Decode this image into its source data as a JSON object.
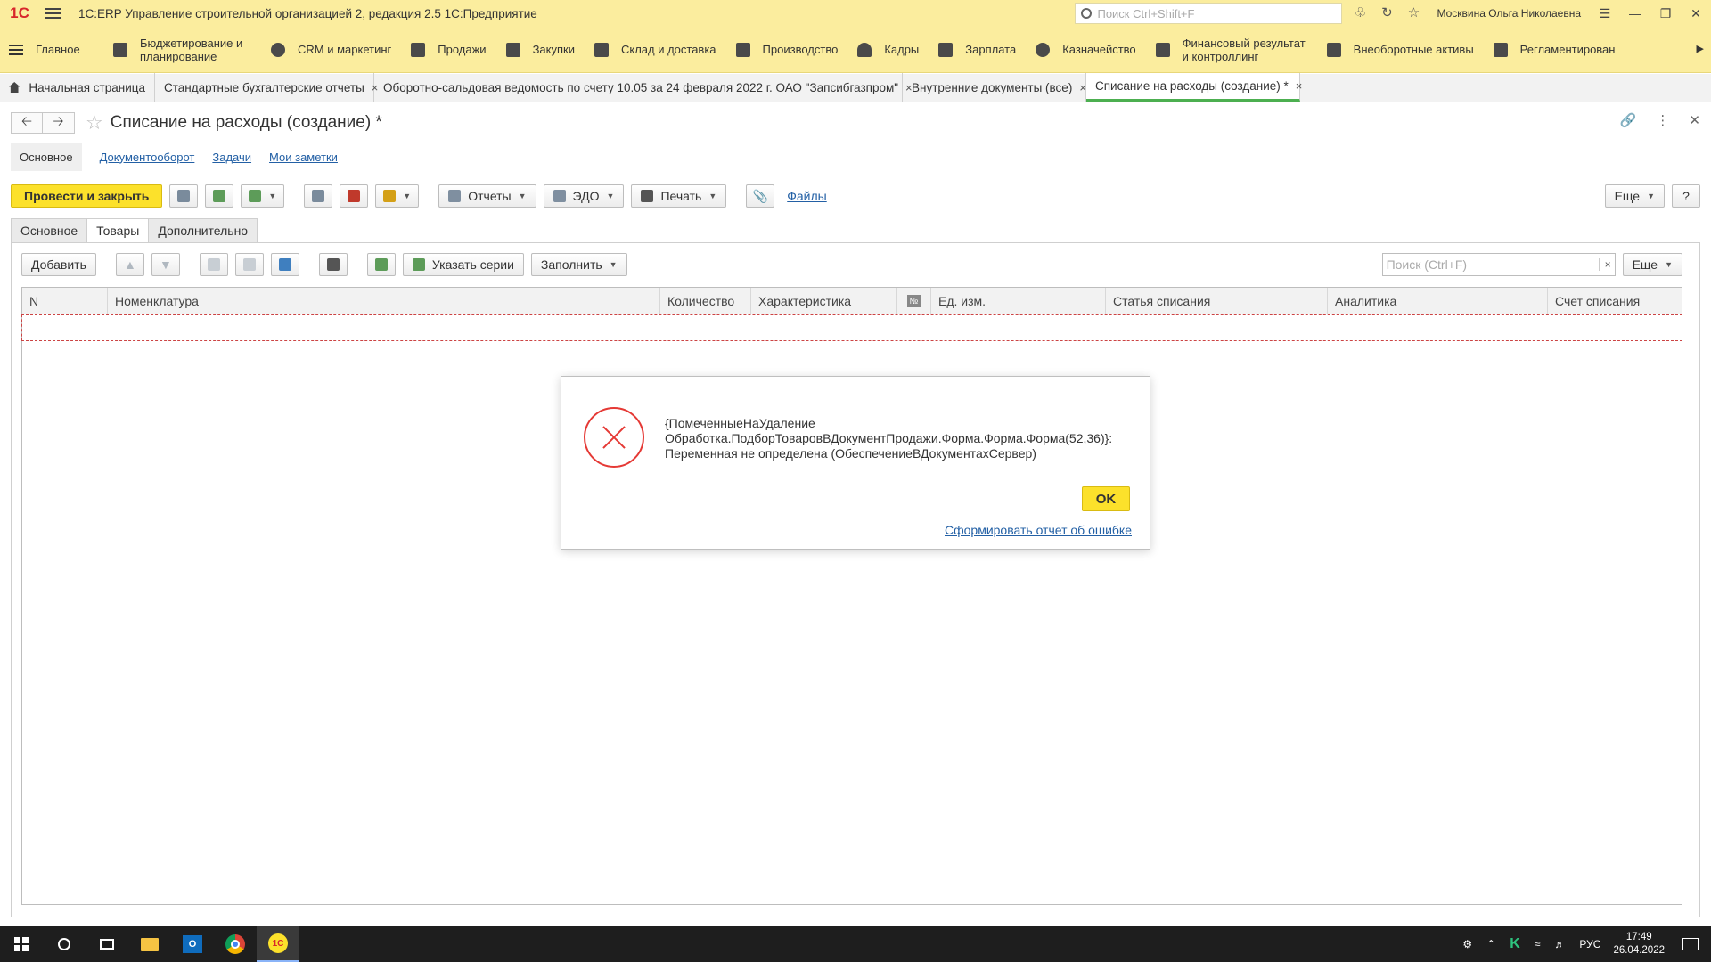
{
  "app": {
    "logo": "1С",
    "title": "1С:ERP Управление строительной организацией 2, редакция 2.5 1С:Предприятие",
    "search_placeholder": "Поиск Ctrl+Shift+F",
    "user": "Москвина Ольга Николаевна"
  },
  "sections": [
    {
      "label": "Главное"
    },
    {
      "label": "Бюджетирование и планирование"
    },
    {
      "label": "CRM и маркетинг"
    },
    {
      "label": "Продажи"
    },
    {
      "label": "Закупки"
    },
    {
      "label": "Склад и доставка"
    },
    {
      "label": "Производство"
    },
    {
      "label": "Кадры"
    },
    {
      "label": "Зарплата"
    },
    {
      "label": "Казначейство"
    },
    {
      "label": "Финансовый результат и контроллинг"
    },
    {
      "label": "Внеоборотные активы"
    },
    {
      "label": "Регламентирован"
    }
  ],
  "open_tabs": [
    {
      "label": "Начальная страница"
    },
    {
      "label": "Стандартные бухгалтерские отчеты",
      "close": "×"
    },
    {
      "label": "Оборотно-сальдовая ведомость по счету 10.05 за 24 февраля 2022 г. ОАО \"Запсибгазпром\"",
      "close": "×"
    },
    {
      "label": "Внутренние документы (все)",
      "close": "×"
    },
    {
      "label": "Списание на расходы (создание) *",
      "close": "×"
    }
  ],
  "form": {
    "title": "Списание на расходы (создание) *",
    "sublinks": [
      "Основное",
      "Документооборот",
      "Задачи",
      "Мои заметки"
    ],
    "commands": {
      "post_close": "Провести и закрыть",
      "reports": "Отчеты",
      "edo": "ЭДО",
      "print": "Печать",
      "files": "Файлы",
      "more": "Еще",
      "help": "?"
    },
    "tabs": [
      "Основное",
      "Товары",
      "Дополнительно"
    ],
    "table_commands": {
      "add": "Добавить",
      "series": "Указать серии",
      "fill": "Заполнить",
      "search_placeholder": "Поиск (Ctrl+F)",
      "clear": "×",
      "more": "Еще"
    },
    "columns": [
      "N",
      "Номенклатура",
      "Количество",
      "Характеристика",
      "№",
      "Ед. изм.",
      "Статья списания",
      "Аналитика",
      "Счет списания"
    ]
  },
  "error_dialog": {
    "line1": "{ПомеченныеНаУдаление",
    "line2": "Обработка.ПодборТоваровВДокументПродажи.Форма.Форма.Форма(52,36)}:",
    "line3": "Переменная не определена (ОбеспечениеВДокументахСервер)",
    "ok": "OK",
    "report_link": "Сформировать отчет об ошибке"
  },
  "taskbar": {
    "lang": "РУС",
    "time": "17:49",
    "date": "26.04.2022"
  }
}
